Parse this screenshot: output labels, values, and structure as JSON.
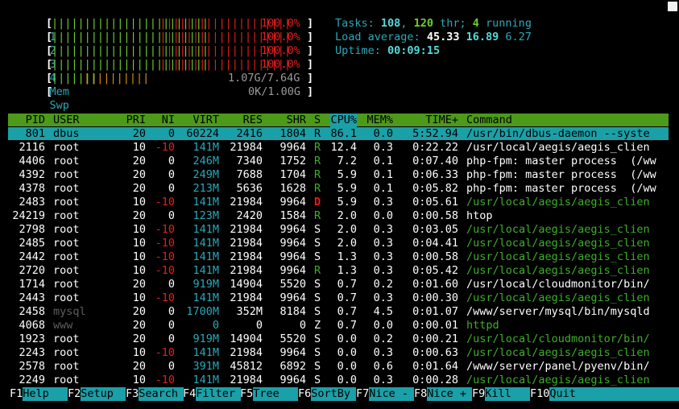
{
  "colors": {
    "header_bg": "#4d9a1a",
    "selected_bg": "#1aa0a8",
    "function_label_bg": "#1aa0a8",
    "low_priority_bar": "#6ccf2a",
    "kernel_bar": "#e81c1c",
    "mem_cache_bar": "#d89018"
  },
  "meters": {
    "cpus": [
      {
        "label": "1",
        "percent": 100.0,
        "text": "100.0%",
        "green_ticks": 24,
        "red_ticks": 20
      },
      {
        "label": "2",
        "percent": 100.0,
        "text": "100.0%",
        "green_ticks": 24,
        "red_ticks": 20
      },
      {
        "label": "3",
        "percent": 100.0,
        "text": "100.0%",
        "green_ticks": 24,
        "red_ticks": 20
      },
      {
        "label": "4",
        "percent": 100.0,
        "text": "100.0%",
        "green_ticks": 24,
        "red_ticks": 20
      }
    ],
    "mem": {
      "label": "Mem",
      "text": "1.07G/7.64G"
    },
    "swp": {
      "label": "Swp",
      "text": "0K/1.00G"
    }
  },
  "summary": {
    "tasks_label": "Tasks:",
    "tasks": "108",
    "thr": "120",
    "thr_label": "thr;",
    "running": "4",
    "running_label": "running",
    "load_label": "Load average:",
    "load1": "45.33",
    "load5": "16.89",
    "load15": "6.27",
    "uptime_label": "Uptime:",
    "uptime": "00:09:15"
  },
  "columns": [
    "PID",
    "USER",
    "PRI",
    "NI",
    "VIRT",
    "RES",
    "SHR",
    "S",
    "CPU%",
    "MEM%",
    "TIME+",
    "Command"
  ],
  "processes": [
    {
      "pid": "801",
      "user": "dbus",
      "pri": "20",
      "ni": "0",
      "virt": "60224",
      "res": "2416",
      "shr": "1804",
      "s": "R",
      "cpu": "86.1",
      "mem": "0.0",
      "time": "5:52.94",
      "cmd": "/usr/bin/dbus-daemon --syste"
    },
    {
      "pid": "2116",
      "user": "root",
      "pri": "10",
      "ni": "-10",
      "virt": "141M",
      "res": "21984",
      "shr": "9964",
      "s": "R",
      "cpu": "12.4",
      "mem": "0.3",
      "time": "0:22.22",
      "cmd": "/usr/local/aegis/aegis_clien"
    },
    {
      "pid": "4406",
      "user": "root",
      "pri": "20",
      "ni": "0",
      "virt": "246M",
      "res": "7340",
      "shr": "1752",
      "s": "R",
      "cpu": "7.2",
      "mem": "0.1",
      "time": "0:07.40",
      "cmd": "php-fpm: master process  (/ww"
    },
    {
      "pid": "4392",
      "user": "root",
      "pri": "20",
      "ni": "0",
      "virt": "249M",
      "res": "7688",
      "shr": "1704",
      "s": "R",
      "cpu": "5.9",
      "mem": "0.1",
      "time": "0:06.33",
      "cmd": "php-fpm: master process  (/ww"
    },
    {
      "pid": "4378",
      "user": "root",
      "pri": "20",
      "ni": "0",
      "virt": "213M",
      "res": "5636",
      "shr": "1628",
      "s": "R",
      "cpu": "5.9",
      "mem": "0.1",
      "time": "0:05.82",
      "cmd": "php-fpm: master process  (/ww"
    },
    {
      "pid": "2483",
      "user": "root",
      "pri": "10",
      "ni": "-10",
      "virt": "141M",
      "res": "21984",
      "shr": "9964",
      "s": "D",
      "cpu": "5.9",
      "mem": "0.3",
      "time": "0:05.61",
      "cmd": "/usr/local/aegis/aegis_clien"
    },
    {
      "pid": "24219",
      "user": "root",
      "pri": "20",
      "ni": "0",
      "virt": "123M",
      "res": "2420",
      "shr": "1584",
      "s": "R",
      "cpu": "2.0",
      "mem": "0.0",
      "time": "0:00.58",
      "cmd": "htop"
    },
    {
      "pid": "2798",
      "user": "root",
      "pri": "10",
      "ni": "-10",
      "virt": "141M",
      "res": "21984",
      "shr": "9964",
      "s": "S",
      "cpu": "2.0",
      "mem": "0.3",
      "time": "0:03.05",
      "cmd": "/usr/local/aegis/aegis_clien"
    },
    {
      "pid": "2485",
      "user": "root",
      "pri": "10",
      "ni": "-10",
      "virt": "141M",
      "res": "21984",
      "shr": "9964",
      "s": "S",
      "cpu": "2.0",
      "mem": "0.3",
      "time": "0:04.41",
      "cmd": "/usr/local/aegis/aegis_clien"
    },
    {
      "pid": "2442",
      "user": "root",
      "pri": "10",
      "ni": "-10",
      "virt": "141M",
      "res": "21984",
      "shr": "9964",
      "s": "S",
      "cpu": "1.3",
      "mem": "0.3",
      "time": "0:00.58",
      "cmd": "/usr/local/aegis/aegis_clien"
    },
    {
      "pid": "2720",
      "user": "root",
      "pri": "10",
      "ni": "-10",
      "virt": "141M",
      "res": "21984",
      "shr": "9964",
      "s": "R",
      "cpu": "1.3",
      "mem": "0.3",
      "time": "0:05.42",
      "cmd": "/usr/local/aegis/aegis_clien"
    },
    {
      "pid": "1714",
      "user": "root",
      "pri": "20",
      "ni": "0",
      "virt": "919M",
      "res": "14904",
      "shr": "5520",
      "s": "S",
      "cpu": "0.7",
      "mem": "0.2",
      "time": "0:01.60",
      "cmd": "/usr/local/cloudmonitor/bin/"
    },
    {
      "pid": "2443",
      "user": "root",
      "pri": "10",
      "ni": "-10",
      "virt": "141M",
      "res": "21984",
      "shr": "9964",
      "s": "S",
      "cpu": "0.7",
      "mem": "0.3",
      "time": "0:00.30",
      "cmd": "/usr/local/aegis/aegis_clien"
    },
    {
      "pid": "2458",
      "user": "mysql",
      "pri": "20",
      "ni": "0",
      "virt": "1700M",
      "res": "352M",
      "shr": "8184",
      "s": "S",
      "cpu": "0.7",
      "mem": "4.5",
      "time": "0:01.07",
      "cmd": "/www/server/mysql/bin/mysqld"
    },
    {
      "pid": "4068",
      "user": "www",
      "pri": "20",
      "ni": "0",
      "virt": "0",
      "res": "0",
      "shr": "0",
      "s": "Z",
      "cpu": "0.7",
      "mem": "0.0",
      "time": "0:00.01",
      "cmd": "httpd"
    },
    {
      "pid": "1923",
      "user": "root",
      "pri": "20",
      "ni": "0",
      "virt": "919M",
      "res": "14904",
      "shr": "5520",
      "s": "S",
      "cpu": "0.0",
      "mem": "0.2",
      "time": "0:00.21",
      "cmd": "/usr/local/cloudmonitor/bin/"
    },
    {
      "pid": "2243",
      "user": "root",
      "pri": "10",
      "ni": "-10",
      "virt": "141M",
      "res": "21984",
      "shr": "9964",
      "s": "S",
      "cpu": "0.0",
      "mem": "0.3",
      "time": "0:00.63",
      "cmd": "/usr/local/aegis/aegis_clien"
    },
    {
      "pid": "2578",
      "user": "root",
      "pri": "20",
      "ni": "0",
      "virt": "391M",
      "res": "45812",
      "shr": "6892",
      "s": "S",
      "cpu": "0.0",
      "mem": "0.6",
      "time": "0:01.64",
      "cmd": "/www/server/panel/pyenv/bin/"
    },
    {
      "pid": "2249",
      "user": "root",
      "pri": "10",
      "ni": "-10",
      "virt": "141M",
      "res": "21984",
      "shr": "9964",
      "s": "S",
      "cpu": "0.0",
      "mem": "0.3",
      "time": "0:00.28",
      "cmd": "/usr/local/aegis/aegis_clien"
    }
  ],
  "function_keys": [
    {
      "key": "F1",
      "label": "Help"
    },
    {
      "key": "F2",
      "label": "Setup"
    },
    {
      "key": "F3",
      "label": "Search"
    },
    {
      "key": "F4",
      "label": "Filter"
    },
    {
      "key": "F5",
      "label": "Tree"
    },
    {
      "key": "F6",
      "label": "SortBy"
    },
    {
      "key": "F7",
      "label": "Nice -"
    },
    {
      "key": "F8",
      "label": "Nice +"
    },
    {
      "key": "F9",
      "label": "Kill"
    },
    {
      "key": "F10",
      "label": "Quit"
    }
  ]
}
